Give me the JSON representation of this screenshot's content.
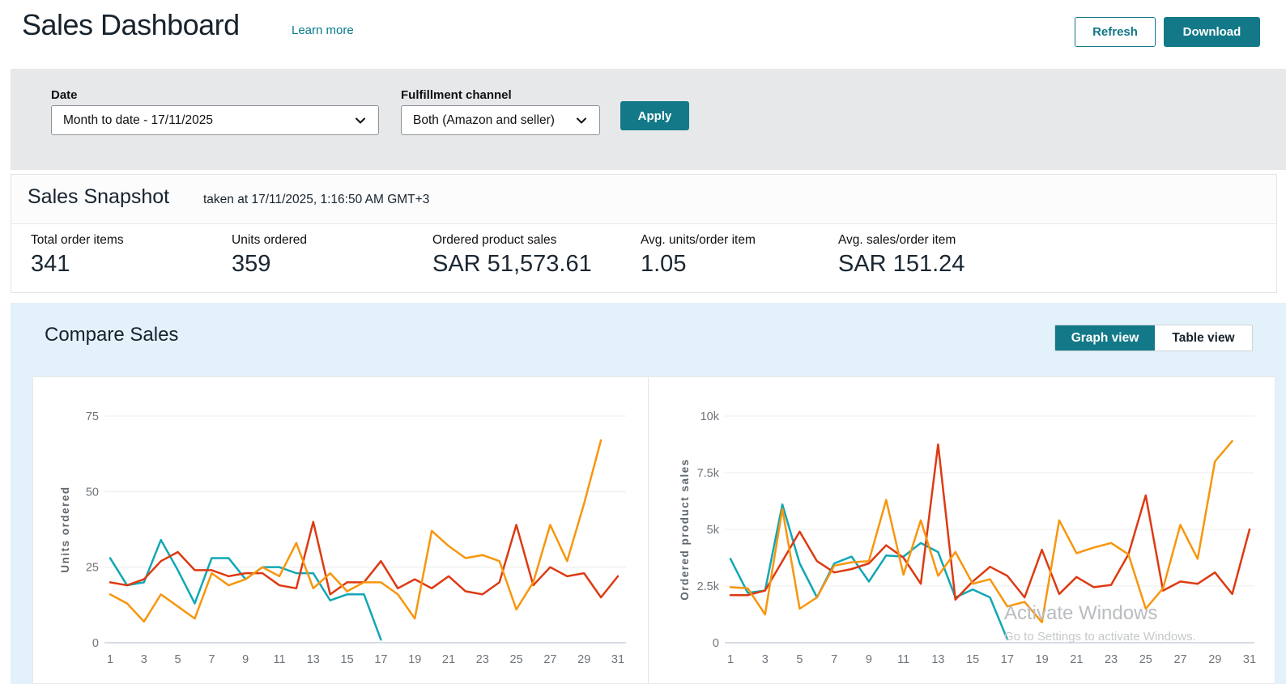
{
  "header": {
    "title": "Sales Dashboard",
    "learn_more": "Learn more",
    "refresh_label": "Refresh",
    "download_label": "Download"
  },
  "filters": {
    "date_label": "Date",
    "date_value": "Month to date - 17/11/2025",
    "channel_label": "Fulfillment channel",
    "channel_value": "Both (Amazon and seller)",
    "apply_label": "Apply"
  },
  "snapshot": {
    "title": "Sales Snapshot",
    "taken_at": "taken at 17/11/2025, 1:16:50 AM GMT+3",
    "metrics": [
      {
        "label": "Total order items",
        "value": "341"
      },
      {
        "label": "Units ordered",
        "value": "359"
      },
      {
        "label": "Ordered product sales",
        "value": "SAR 51,573.61"
      },
      {
        "label": "Avg. units/order item",
        "value": "1.05"
      },
      {
        "label": "Avg. sales/order item",
        "value": "SAR 151.24"
      }
    ]
  },
  "compare": {
    "title": "Compare Sales",
    "graph_view_label": "Graph view",
    "table_view_label": "Table view"
  },
  "watermark": {
    "line1": "Activate Windows",
    "line2": "Go to Settings to activate Windows."
  },
  "colors": {
    "accent_teal": "#137988",
    "section_blue": "#e2f1fa",
    "series_teal": "#10a7b5",
    "series_red": "#dd3a12",
    "series_orange": "#f7960d"
  },
  "chart_data": [
    {
      "type": "line",
      "title": "Units ordered by day",
      "xlabel": "",
      "ylabel": "Units ordered",
      "xlim": [
        1,
        31
      ],
      "ylim": [
        0,
        75
      ],
      "grid": true,
      "legend": "none",
      "xticks": [
        1,
        3,
        5,
        7,
        9,
        11,
        13,
        15,
        17,
        19,
        21,
        23,
        25,
        27,
        29,
        31
      ],
      "yticks": [
        0,
        25,
        50,
        75
      ],
      "ytick_labels": [
        "0",
        "25",
        "50",
        "75"
      ],
      "series": [
        {
          "name": "teal-line",
          "color": "#10a7b5",
          "values": [
            28,
            19,
            20,
            34,
            24,
            13,
            28,
            28,
            21,
            25,
            25,
            23,
            23,
            14,
            16,
            16,
            1
          ]
        },
        {
          "name": "red-line",
          "color": "#dd3a12",
          "values": [
            20,
            19,
            21,
            27,
            30,
            24,
            24,
            22,
            23,
            23,
            19,
            18,
            40,
            16,
            20,
            20,
            27,
            18,
            21,
            18,
            22,
            17,
            16,
            20,
            39,
            19,
            25,
            22,
            23,
            15,
            22
          ]
        },
        {
          "name": "orange-line",
          "color": "#f7960d",
          "values": [
            16,
            13,
            7,
            16,
            12,
            8,
            23,
            19,
            21,
            25,
            22,
            33,
            18,
            23,
            17,
            20,
            20,
            16,
            8,
            37,
            32,
            28,
            29,
            27,
            11,
            20,
            39,
            27,
            46,
            67
          ]
        }
      ]
    },
    {
      "type": "line",
      "title": "Ordered product sales by day",
      "xlabel": "",
      "ylabel": "Ordered product sales",
      "xlim": [
        1,
        31
      ],
      "ylim": [
        0,
        10000
      ],
      "grid": true,
      "legend": "none",
      "xticks": [
        1,
        3,
        5,
        7,
        9,
        11,
        13,
        15,
        17,
        19,
        21,
        23,
        25,
        27,
        29,
        31
      ],
      "yticks": [
        0,
        2500,
        5000,
        7500,
        10000
      ],
      "ytick_labels": [
        "0",
        "2.5k",
        "5k",
        "7.5k",
        "10k"
      ],
      "series": [
        {
          "name": "teal-line",
          "color": "#10a7b5",
          "values": [
            3700,
            2200,
            2300,
            6100,
            3500,
            2000,
            3500,
            3800,
            2700,
            3850,
            3800,
            4400,
            4000,
            2000,
            2350,
            2000,
            150
          ]
        },
        {
          "name": "red-line",
          "color": "#dd3a12",
          "values": [
            2100,
            2100,
            2300,
            3600,
            4900,
            3600,
            3100,
            3250,
            3500,
            4300,
            3750,
            2600,
            8750,
            1900,
            2700,
            3350,
            2950,
            2000,
            4100,
            2150,
            2900,
            2450,
            2550,
            3900,
            6500,
            2300,
            2700,
            2600,
            3100,
            2150,
            5000
          ]
        },
        {
          "name": "orange-line",
          "color": "#f7960d",
          "values": [
            2450,
            2400,
            1250,
            5900,
            1500,
            2000,
            3400,
            3550,
            3600,
            6300,
            3000,
            5400,
            2950,
            4000,
            2600,
            2800,
            1600,
            1800,
            900,
            5400,
            3950,
            4200,
            4400,
            3900,
            1500,
            2400,
            5200,
            3700,
            8000,
            8900
          ]
        }
      ]
    }
  ]
}
